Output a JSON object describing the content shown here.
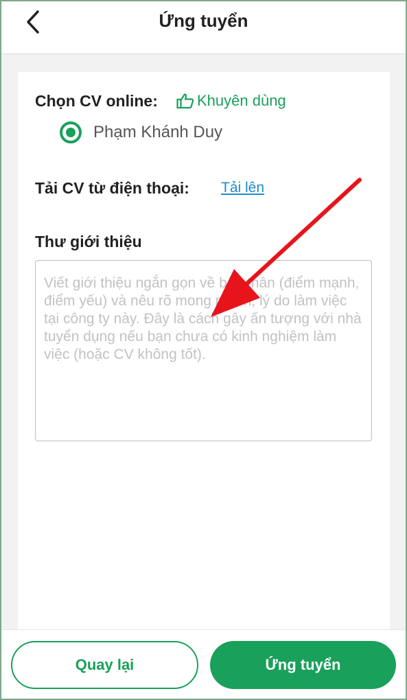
{
  "header": {
    "title": "Ứng tuyển",
    "back_icon": "chevron-left-icon"
  },
  "cv_section": {
    "choose_label": "Chọn CV online:",
    "recommend_icon": "thumbs-up-icon",
    "recommend_label": "Khuyên dùng",
    "selected_cv": "Phạm Khánh Duy",
    "upload_label": "Tải CV từ điện thoại:",
    "upload_link": "Tải lên"
  },
  "cover_letter": {
    "title": "Thư giới thiệu",
    "placeholder": "Viết giới thiệu ngắn gọn về bản thân (điểm mạnh, điểm yếu) và nêu rõ mong muốn, lý do làm việc tại công ty này. Đây là cách gây ấn tượng với nhà tuyển dụng nếu bạn chưa có kinh nghiệm làm việc (hoặc CV không tốt)."
  },
  "footer": {
    "back_label": "Quay lại",
    "apply_label": "Ứng tuyển"
  },
  "colors": {
    "accent": "#19a05a",
    "link": "#1d8bd0",
    "annotation_arrow": "#e8141c"
  }
}
